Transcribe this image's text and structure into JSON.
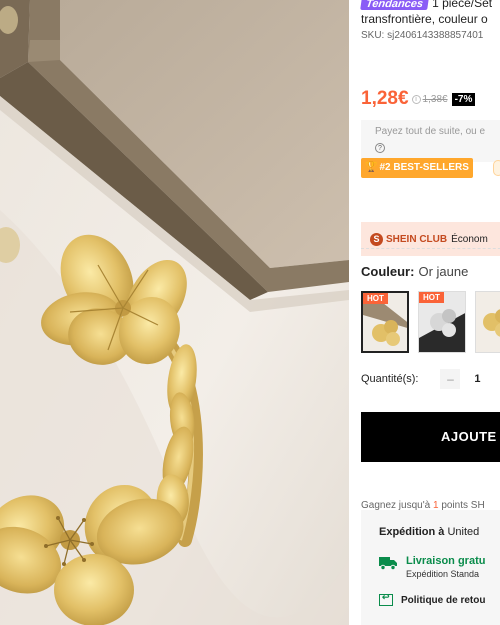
{
  "product": {
    "trend_badge": "Tendances",
    "title_line1": "1 pièce/Set",
    "title_line2": "transfrontière, couleur o",
    "sku": "SKU: sj2406143388857401"
  },
  "price": {
    "current": "1,28€",
    "info_icon": "i",
    "original": "1,38€",
    "discount": "-7%"
  },
  "payment": {
    "text": "Payez tout de suite, ou e",
    "help_icon": "?"
  },
  "bestseller": {
    "label": "#2 BEST-SELLERS",
    "icon": "trophy-icon"
  },
  "club": {
    "logo_letter": "S",
    "name": "SHEIN CLUB",
    "text": "Économ"
  },
  "color": {
    "label": "Couleur:",
    "value": "Or jaune",
    "hot_label": "HOT"
  },
  "quantity": {
    "label": "Quantité(s):",
    "minus": "–",
    "value": "1"
  },
  "cart": {
    "add_label": "AJOUTE"
  },
  "points": {
    "prefix": "Gagnez jusqu'à",
    "num": "1",
    "suffix": "points SH"
  },
  "shipping": {
    "title_bold": "Expédition à",
    "title_dest": "United",
    "free_title": "Livraison gratu",
    "free_sub": "Expédition Standa",
    "return_label": "Politique de retou"
  },
  "colors": {
    "accent": "#fa6338",
    "badge_purple": "#8a5cf6",
    "bestseller": "#ffa72c",
    "club_bg": "#fde6dd",
    "green": "#0a8c4b"
  }
}
